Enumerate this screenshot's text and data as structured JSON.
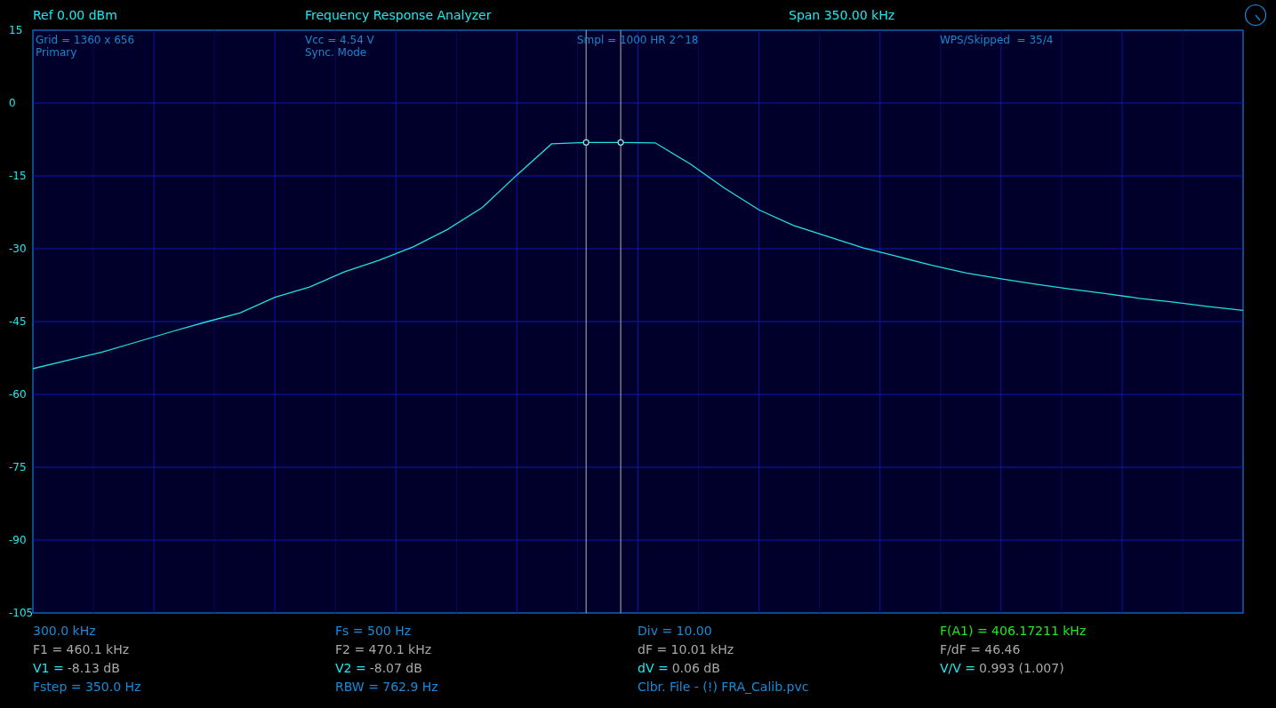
{
  "header": {
    "reference": "Ref  0.00 dBm",
    "title": "Frequency Response Analyzer",
    "span": "Span 350.00 kHz"
  },
  "overlay": [
    {
      "lines": [
        "Grid = 1360 x 656",
        "Primary"
      ]
    },
    {
      "lines": [
        "Vcc = 4.54 V",
        "Sync. Mode"
      ]
    },
    {
      "lines": [
        "Smpl = 1000 HR 2^18"
      ]
    },
    {
      "lines": [
        "WPS/Skipped  = 35/4"
      ]
    }
  ],
  "chart_data": {
    "type": "line",
    "grid": true,
    "ylim": [
      -105,
      15
    ],
    "yticks": [
      15,
      0,
      -15,
      -30,
      -45,
      -60,
      -75,
      -90,
      -105
    ],
    "categories": [
      null,
      null,
      null,
      null,
      null,
      null,
      null,
      null,
      null,
      null,
      null,
      null,
      null,
      null,
      null,
      null,
      null,
      null,
      null,
      null,
      null,
      null,
      null,
      null,
      null,
      null,
      null,
      null,
      null,
      null,
      null,
      null,
      null,
      null,
      null,
      null
    ],
    "series": [
      {
        "color": "#22e0e0",
        "values": [
          -54.7,
          -53.0,
          -51.3,
          -49.2,
          -47.1,
          -45.1,
          -43.2,
          -40.0,
          -37.9,
          -34.8,
          -32.4,
          -29.6,
          -26.0,
          -21.5,
          -14.8,
          -8.4,
          -8.1,
          -8.1,
          -8.2,
          -12.5,
          -17.5,
          -22.0,
          -25.2,
          -27.5,
          -29.8,
          -31.6,
          -33.4,
          -35.0,
          -36.2,
          -37.3,
          -38.3,
          -39.2,
          -40.2,
          -41.0,
          -41.9,
          -42.7
        ]
      },
      {
        "color": "#9ee8f0",
        "marker": "circle",
        "values": [
          null,
          null,
          null,
          null,
          null,
          null,
          null,
          null,
          null,
          null,
          null,
          null,
          null,
          null,
          null,
          null,
          -8.1,
          null,
          null,
          null,
          null,
          null,
          null,
          null,
          null,
          null,
          null,
          null,
          null,
          null,
          null,
          null,
          null,
          null,
          null,
          null
        ]
      },
      {
        "color": "#9ee8f0",
        "marker": "circle",
        "values": [
          null,
          null,
          null,
          null,
          null,
          null,
          null,
          null,
          null,
          null,
          null,
          null,
          null,
          null,
          null,
          null,
          null,
          -8.1,
          null,
          null,
          null,
          null,
          null,
          null,
          null,
          null,
          null,
          null,
          null,
          null,
          null,
          null,
          null,
          null,
          null,
          null
        ]
      }
    ]
  },
  "readouts": [
    {
      "items": [
        {
          "kind": "info",
          "text": "300.0 kHz"
        },
        {
          "kind": "measure",
          "text": "F1 = 460.1 kHz"
        },
        {
          "kind": "marker",
          "label": "V1 =",
          "value": "-8.13 dB"
        },
        {
          "kind": "info",
          "text": "Fstep = 350.0 Hz"
        }
      ]
    },
    {
      "items": [
        {
          "kind": "info",
          "text": "Fs = 500 Hz"
        },
        {
          "kind": "measure",
          "text": "F2 = 470.1 kHz"
        },
        {
          "kind": "marker",
          "label": "V2 =",
          "value": "-8.07 dB"
        },
        {
          "kind": "info",
          "text": "RBW = 762.9 Hz"
        }
      ]
    },
    {
      "items": [
        {
          "kind": "info",
          "text": "Div = 10.00"
        },
        {
          "kind": "measure",
          "text": "dF = 10.01 kHz"
        },
        {
          "kind": "marker",
          "label": "dV =",
          "value": "0.06 dB"
        },
        {
          "kind": "info",
          "text": "Clbr. File - (!) FRA_Calib.pvc"
        }
      ]
    },
    {
      "items": [
        {
          "kind": "highlight",
          "text": "F(A1) = 406.17211 kHz"
        },
        {
          "kind": "measure",
          "text": "F/dF = 46.46"
        },
        {
          "kind": "marker",
          "label": "V/V =",
          "value": "0.993 (1.007)"
        }
      ]
    }
  ]
}
